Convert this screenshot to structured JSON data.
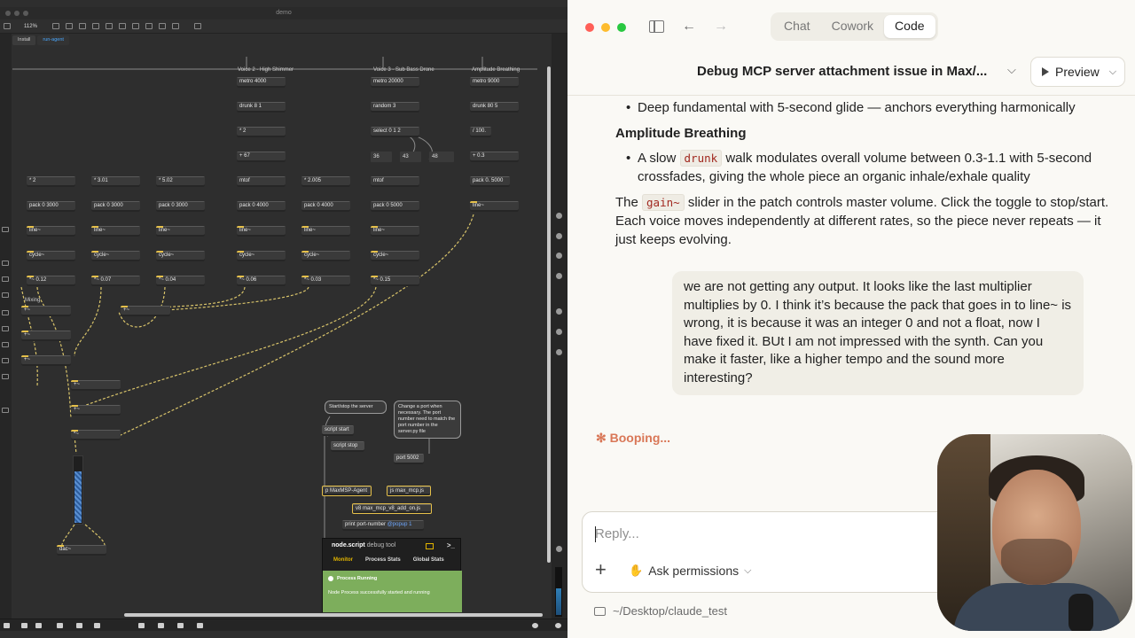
{
  "max": {
    "window_title": "demo",
    "zoom": "112%",
    "tabs": [
      "Install",
      "run-agent"
    ],
    "section_labels": {
      "voice2": "Voice 2 - High Shimmer",
      "voice3": "Voice 3 - Sub Bass Drone",
      "amp": "Amplitude Breathing",
      "mixing": "Mixing"
    },
    "objects": {
      "metro4000": "metro 4000",
      "drunk81": "drunk 8 1",
      "mul2": "* 2",
      "add67": "+ 67",
      "mtof1": "mtof",
      "metro20000": "metro 20000",
      "random3": "random 3",
      "select012": "select 0 1 2",
      "n36": "36",
      "n43": "43",
      "n48": "48",
      "mtof2": "mtof",
      "metro9000": "metro 9000",
      "drunk805": "drunk 80 5",
      "div100": "/ 100.",
      "add03": "+ 0.3",
      "pack05000a": "pack 0. 5000",
      "line_amp": "line~",
      "mul_2": "* 2",
      "mul_301": "* 3.01",
      "mul_502": "* 5.02",
      "mul_2005": "* 2.005",
      "pack3000a": "pack 0 3000",
      "pack3000b": "pack 0 3000",
      "pack3000c": "pack 0 3000",
      "pack4000a": "pack 0 4000",
      "pack4000b": "pack 0 4000",
      "pack5000": "pack 0 5000",
      "line1": "line~",
      "line2": "line~",
      "line3": "line~",
      "line4": "line~",
      "line5": "line~",
      "line6": "line~",
      "cycle1": "cycle~",
      "cycle2": "cycle~",
      "cycle3": "cycle~",
      "cycle4": "cycle~",
      "cycle5": "cycle~",
      "cycle6": "cycle~",
      "g012": "*~ 0.12",
      "g007": "*~ 0.07",
      "g004": "*~ 0.04",
      "g006": "*~ 0.06",
      "g003": "*~ 0.03",
      "g015": "*~ 0.15",
      "mix1": "+~",
      "mix2": "+~",
      "mix3": "+~",
      "mix4": "+~",
      "mix5": "+~",
      "mix6": "+~",
      "mix7": "*~",
      "dac": "dac~",
      "script_start": "script start",
      "script_stop": "script stop",
      "port": "port 5002",
      "p_agent": "p MaxMSP-Agent",
      "js_mcp": "js max_mcp.js",
      "v8_addon": "v8 max_mcp_v8_add_on.js",
      "print_port": "print port-number",
      "popup_attr": "@popup 1"
    },
    "comments": {
      "startstop": "Start/stop the server",
      "port_note": "Change a port when necessary. The port number need to match the port number in the server.py file"
    },
    "debug": {
      "title": "node.script",
      "subtitle": "debug tool",
      "tabs": [
        "Monitor",
        "Process Stats",
        "Global Stats"
      ],
      "status": "Process Running",
      "status_detail": "Node Process successfully started and running",
      "accent": "#e0b300",
      "ok_color": "#7dae5c"
    }
  },
  "app": {
    "nav_tabs": [
      "Chat",
      "Cowork",
      "Code"
    ],
    "active_tab": "Code",
    "conversation_title": "Debug MCP server attachment issue in Max/...",
    "preview_label": "Preview",
    "assistant": {
      "bullet1": "Deep fundamental with 5-second glide — anchors everything harmonically",
      "heading": "Amplitude Breathing",
      "bullet2_pre": "A slow",
      "bullet2_code": "drunk",
      "bullet2_post": "walk modulates overall volume between 0.3-1.1 with 5-second crossfades, giving the whole piece an organic inhale/exhale quality",
      "para_pre": "The",
      "para_code": "gain~",
      "para_post": "slider in the patch controls master volume. Click the toggle to stop/start. Each voice moves independently at different rates, so the piece never repeats — it just keeps evolving."
    },
    "user_message": "we are not getting any output. It looks like the last multiplier multiplies by 0. I think it’s because the pack that goes in to line~ is wrong, it is because it was an integer 0 and not a float, now I have fixed it. BUt I am not impressed with the synth. Can you make it faster, like a higher tempo and the sound more interesting?",
    "status": "✻ Booping...",
    "reply_placeholder": "Reply...",
    "ask_permissions": "Ask permissions",
    "path": "~/Desktop/claude_test",
    "colors": {
      "accent": "#d97757",
      "code_text": "#a1281f",
      "background": "#faf9f5"
    }
  }
}
